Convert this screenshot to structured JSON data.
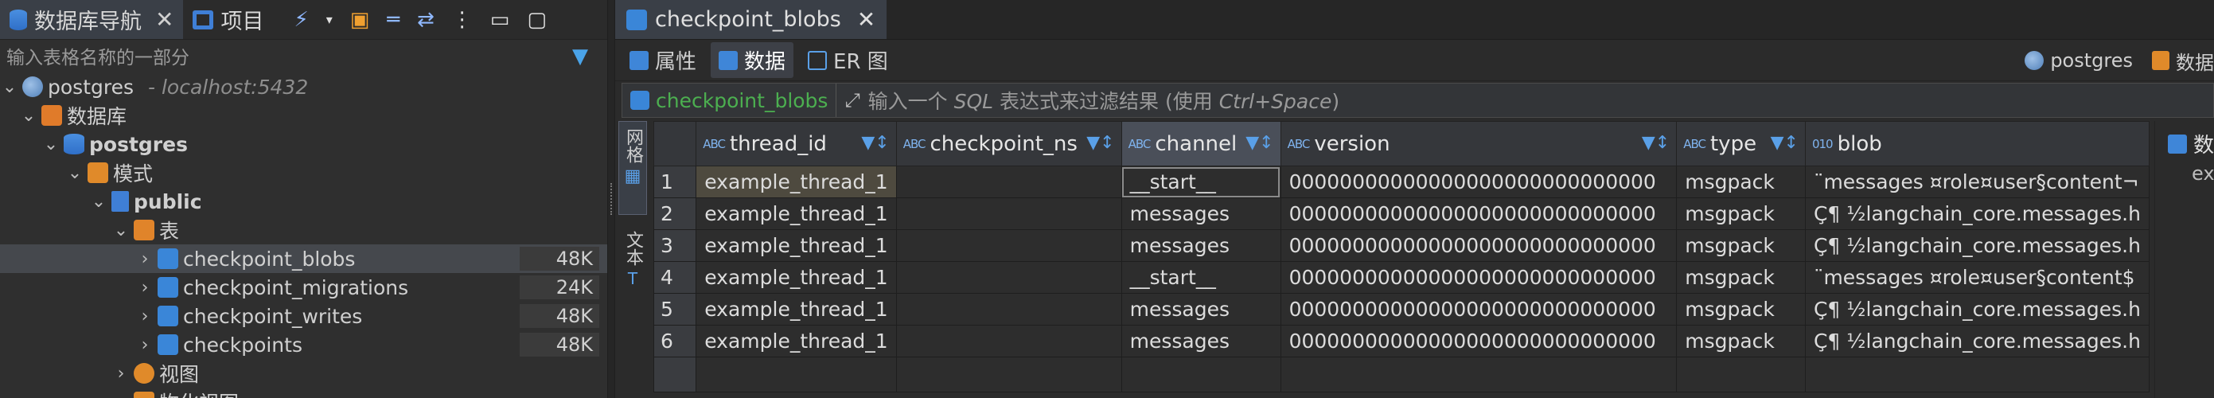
{
  "left_tabs": [
    {
      "label": "数据库导航",
      "icon": "database-icon",
      "closable": true
    },
    {
      "label": "项目",
      "icon": "project-icon"
    }
  ],
  "left_tools": [
    "new-connection-icon",
    "dropdown-icon",
    "new-folder-icon",
    "collapse-icon",
    "link-icon",
    "menu-icon",
    "minimize-icon",
    "maximize-icon"
  ],
  "filter_placeholder": "输入表格名称的一部分",
  "tree": [
    {
      "label": "postgres",
      "sub": "- localhost:5432",
      "icon": "postgres-icon"
    },
    {
      "label": "数据库",
      "icon": "databases-icon"
    },
    {
      "label": "postgres",
      "icon": "database-icon"
    },
    {
      "label": "模式",
      "icon": "schemas-icon"
    },
    {
      "label": "public",
      "icon": "schema-icon"
    },
    {
      "label": "表",
      "icon": "tables-icon"
    },
    {
      "label": "checkpoint_blobs",
      "size": "48K",
      "icon": "table-icon"
    },
    {
      "label": "checkpoint_migrations",
      "size": "24K",
      "icon": "table-icon"
    },
    {
      "label": "checkpoint_writes",
      "size": "48K",
      "icon": "table-icon"
    },
    {
      "label": "checkpoints",
      "size": "48K",
      "icon": "table-icon"
    },
    {
      "label": "视图",
      "icon": "views-icon"
    },
    {
      "label": "物化视图",
      "icon": "mat-views-icon"
    }
  ],
  "editor_tab": {
    "label": "checkpoint_blobs",
    "closable": true
  },
  "sub_tabs": [
    "属性",
    "数据",
    "ER 图"
  ],
  "connection": "postgres",
  "connection_db": "数据",
  "filter_bar": {
    "table_label": "checkpoint_blobs",
    "placeholder_a": "输入一个 ",
    "placeholder_sql": "SQL",
    "placeholder_b": " 表达式来过滤结果 (使用 ",
    "placeholder_key": "Ctrl+Space",
    "placeholder_c": ")"
  },
  "side_tabs": [
    "网格",
    "文本"
  ],
  "columns": [
    "thread_id",
    "checkpoint_ns",
    "channel",
    "version",
    "type",
    "blob"
  ],
  "rows": [
    {
      "n": "1",
      "thread_id": "example_thread_1",
      "checkpoint_ns": "",
      "channel": "__start__",
      "version": "00000000000000000000000000000",
      "type": "msgpack",
      "blob": "¨messages ¤role¤user§content¬"
    },
    {
      "n": "2",
      "thread_id": "example_thread_1",
      "checkpoint_ns": "",
      "channel": "messages",
      "version": "00000000000000000000000000000",
      "type": "msgpack",
      "blob": "Ç¶ ½langchain_core.messages.h"
    },
    {
      "n": "3",
      "thread_id": "example_thread_1",
      "checkpoint_ns": "",
      "channel": "messages",
      "version": "00000000000000000000000000000",
      "type": "msgpack",
      "blob": "Ç¶ ½langchain_core.messages.h"
    },
    {
      "n": "4",
      "thread_id": "example_thread_1",
      "checkpoint_ns": "",
      "channel": "__start__",
      "version": "00000000000000000000000000000",
      "type": "msgpack",
      "blob": "¨messages ¤role¤user§content$"
    },
    {
      "n": "5",
      "thread_id": "example_thread_1",
      "checkpoint_ns": "",
      "channel": "messages",
      "version": "00000000000000000000000000000",
      "type": "msgpack",
      "blob": "Ç¶ ½langchain_core.messages.h"
    },
    {
      "n": "6",
      "thread_id": "example_thread_1",
      "checkpoint_ns": "",
      "channel": "messages",
      "version": "00000000000000000000000000000",
      "type": "msgpack",
      "blob": "Ç¶ ½langchain_core.messages.h"
    }
  ],
  "right_strip": {
    "head": "数",
    "sub": "ex"
  },
  "colors": {
    "accent": "#3f86d8",
    "green_label": "#4caf50",
    "selected_row": "#4e4a3f"
  }
}
